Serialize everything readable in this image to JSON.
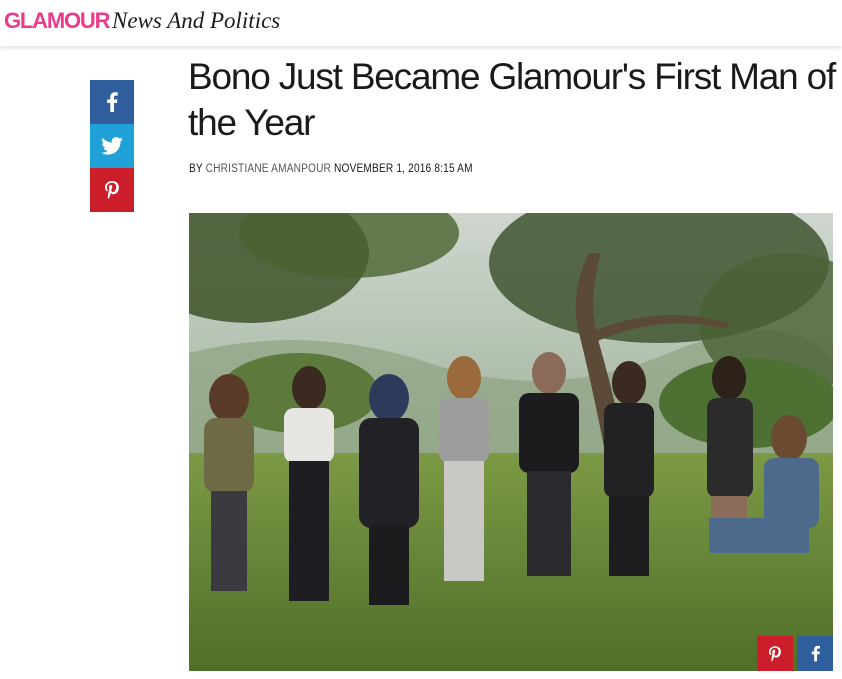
{
  "header": {
    "brand": "GLAMOUR",
    "brand_color": "#ec3b8a",
    "section": "News And Politics"
  },
  "share": {
    "facebook_color": "#2f5e9c",
    "twitter_color": "#1fa1d8",
    "pinterest_color": "#cc1d2a",
    "icons": [
      "facebook-icon",
      "twitter-icon",
      "pinterest-icon"
    ]
  },
  "article": {
    "title": "Bono Just Became Glamour's First Man of the Year",
    "byline_prefix": "BY",
    "author": "CHRISTIANE AMANPOUR",
    "date": "NOVEMBER 1, 2016 8:15 AM"
  },
  "hero_image": {
    "share_icons": [
      "pinterest-icon",
      "facebook-icon"
    ],
    "pinterest_color": "#cc1d2a",
    "facebook_color": "#2f5e9c"
  }
}
